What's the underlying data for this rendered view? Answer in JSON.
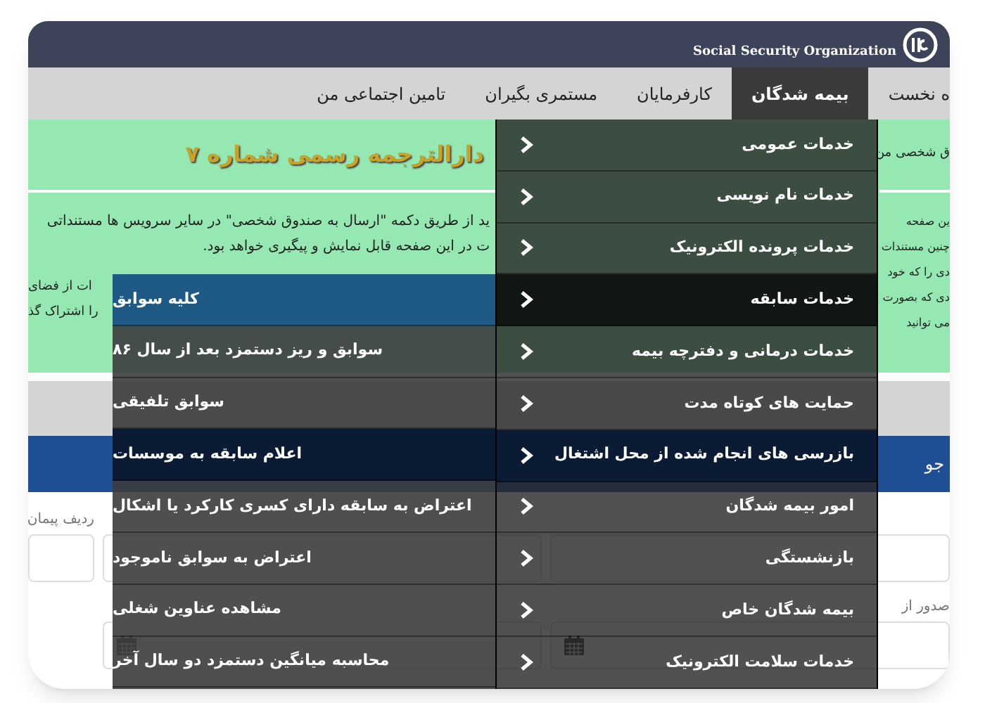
{
  "header": {
    "org_name": "Social Security Organization"
  },
  "nav": [
    {
      "label": "ه نخست",
      "selected": false
    },
    {
      "label": "بیمه شدگان",
      "selected": true
    },
    {
      "label": "کارفرمایان",
      "selected": false
    },
    {
      "label": "مستمری بگیران",
      "selected": false
    },
    {
      "label": "تامین اجتماعی من",
      "selected": false
    }
  ],
  "notice": {
    "title": "دارالترجمه رسمی شماره ۷",
    "lines_left": [
      "ید از طریق دکمه \"ارسال به صندوق شخصی\" در سایر سرویس ها مستنداتی",
      "ت در این صفحه قابل نمایش و پیگیری خواهد بود."
    ],
    "lines_strip": [
      "ات از فضای",
      "را اشتراک گذ"
    ],
    "heading_right": "ق شخصی من",
    "lines_right": [
      "ین صفحه",
      "چنین مستندات",
      "دی را که خود",
      "دی که بصورت",
      "می توانید"
    ]
  },
  "search_bar": {
    "title": "جو"
  },
  "form": {
    "rows": [
      [
        {
          "kind": "text",
          "label": "ردیف پیمان"
        },
        {
          "kind": "text"
        },
        {
          "kind": "text"
        }
      ],
      [
        {
          "kind": "none"
        },
        {
          "kind": "date"
        },
        {
          "kind": "date",
          "label": "صدور از"
        }
      ]
    ]
  },
  "menu": {
    "items": [
      {
        "label": "خدمات عمومی",
        "selected": false,
        "hovered": false
      },
      {
        "label": "خدمات نام نویسی",
        "selected": false,
        "hovered": false
      },
      {
        "label": "خدمات پرونده الکترونیک",
        "selected": false,
        "hovered": false
      },
      {
        "label": "خدمات سابقه",
        "selected": true,
        "hovered": false
      },
      {
        "label": "خدمات درمانی و دفترچه بیمه",
        "selected": false,
        "hovered": false
      },
      {
        "label": "حمایت های کوتاه مدت",
        "selected": false,
        "hovered": false
      },
      {
        "label": "بازرسی های انجام شده از محل اشتغال",
        "selected": false,
        "hovered": true
      },
      {
        "label": "امور بیمه شدگان",
        "selected": false,
        "hovered": false
      },
      {
        "label": "بازنشستگی",
        "selected": false,
        "hovered": false
      },
      {
        "label": "بیمه شدگان خاص",
        "selected": false,
        "hovered": false
      },
      {
        "label": "خدمات سلامت الکترونیک",
        "selected": false,
        "hovered": false
      }
    ]
  },
  "submenu": {
    "items": [
      {
        "label": "کلیه سوابق",
        "selected": true,
        "hovered": false
      },
      {
        "label": "سوابق و ریز دستمزد بعد از سال ۸۶",
        "selected": false,
        "hovered": false
      },
      {
        "label": "سوابق تلفیقی",
        "selected": false,
        "hovered": false
      },
      {
        "label": "اعلام سابقه به موسسات",
        "selected": false,
        "hovered": true
      },
      {
        "label": "اعتراض به سابقه دارای کسری کارکرد یا اشکال",
        "selected": false,
        "hovered": false
      },
      {
        "label": "اعتراض به سوابق ناموجود",
        "selected": false,
        "hovered": false
      },
      {
        "label": "مشاهده عناوین شغلی",
        "selected": false,
        "hovered": false
      },
      {
        "label": "محاسبه میانگین دستمزد دو سال آخر",
        "selected": false,
        "hovered": false
      }
    ]
  }
}
